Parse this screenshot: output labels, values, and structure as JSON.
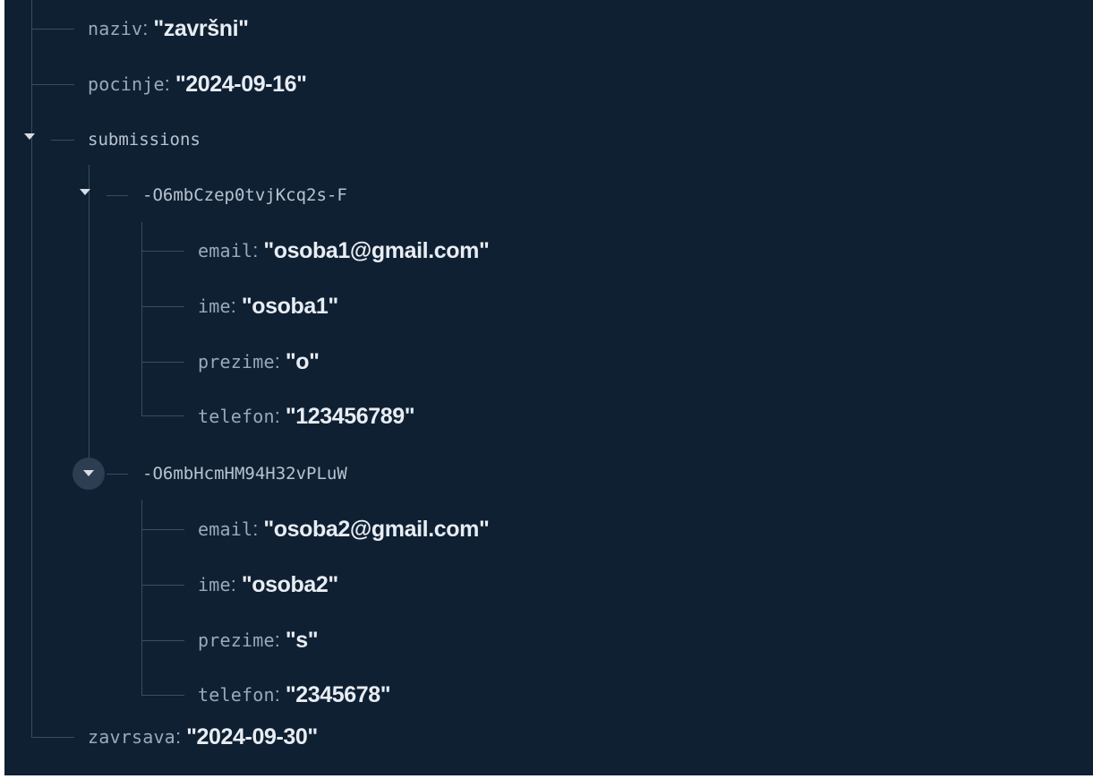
{
  "tree": {
    "naziv": {
      "key": "naziv",
      "value": "\"završni\""
    },
    "pocinje": {
      "key": "pocinje",
      "value": "\"2024-09-16\""
    },
    "submissions": {
      "key": "submissions",
      "expanded": true,
      "items": [
        {
          "key": "-O6mbCzep0tvjKcq2s-F",
          "expanded": true,
          "fields": [
            {
              "key": "email",
              "value": "\"osoba1@gmail.com\""
            },
            {
              "key": "ime",
              "value": "\"osoba1\""
            },
            {
              "key": "prezime",
              "value": "\"o\""
            },
            {
              "key": "telefon",
              "value": "\"123456789\""
            }
          ]
        },
        {
          "key": "-O6mbHcmHM94H32vPLuW",
          "expanded": true,
          "fields": [
            {
              "key": "email",
              "value": "\"osoba2@gmail.com\""
            },
            {
              "key": "ime",
              "value": "\"osoba2\""
            },
            {
              "key": "prezime",
              "value": "\"s\""
            },
            {
              "key": "telefon",
              "value": "\"2345678\""
            }
          ]
        }
      ]
    },
    "zavrsava": {
      "key": "zavrsava",
      "value": "\"2024-09-30\""
    }
  },
  "colors": {
    "background": "#0f2033",
    "tree_line": "#3a4c61",
    "key_text": "#9aa9ba",
    "value_text": "#e8edf3",
    "toggle_hover": "#2d3d52"
  },
  "icons": {
    "expand_toggle": "caret-down-icon"
  }
}
